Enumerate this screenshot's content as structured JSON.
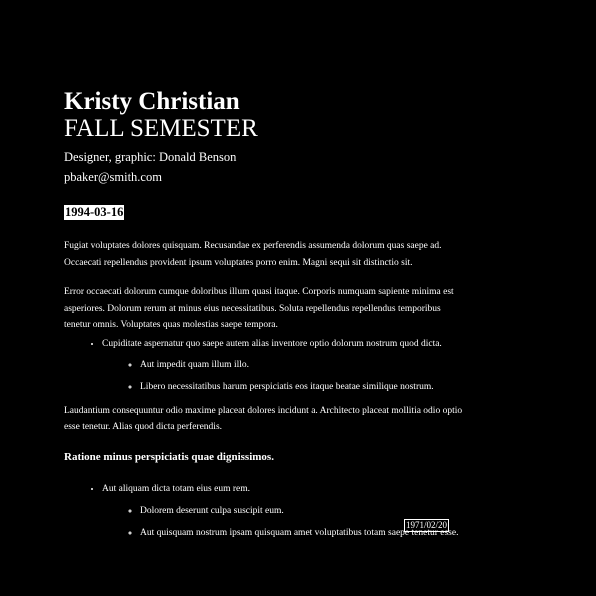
{
  "header": {
    "name": "Kristy Christian",
    "title": "FALL SEMESTER",
    "designer": "Designer, graphic: Donald Benson",
    "email": "pbaker@smith.com",
    "date": "1994-03-16"
  },
  "body": {
    "paragraph_1": "Fugiat voluptates dolores quisquam. Recusandae ex perferendis assumenda dolorum quas saepe ad. Occaecati repellendus provident ipsum voluptates porro enim. Magni sequi sit distinctio sit.",
    "paragraph_2": "Error occaecati dolorum cumque doloribus illum quasi itaque. Corporis numquam sapiente minima est asperiores. Dolorum rerum at minus eius necessitatibus. Soluta repellendus repellendus temporibus tenetur omnis. Voluptates quas molestias saepe tempora.",
    "list_1": {
      "item": "Cupiditate aspernatur quo saepe autem alias inventore optio dolorum nostrum quod dicta.",
      "subitems": [
        "Aut impedit quam illum illo.",
        "Libero necessitatibus harum perspiciatis eos itaque beatae similique nostrum."
      ]
    },
    "paragraph_3": "Laudantium consequuntur odio maxime placeat dolores incidunt a. Architecto placeat mollitia odio optio esse tenetur. Alias quod dicta perferendis.",
    "heading": "Ratione minus perspiciatis quae dignissimos.",
    "list_2": {
      "item": "Aut aliquam dicta totam eius eum rem.",
      "subitems": [
        "Dolorem deserunt culpa suscipit eum.",
        "Aut quisquam nostrum ipsam quisquam amet voluptatibus totam saepe tenetur esse."
      ]
    }
  },
  "footer": {
    "date": "1971/02/20"
  }
}
